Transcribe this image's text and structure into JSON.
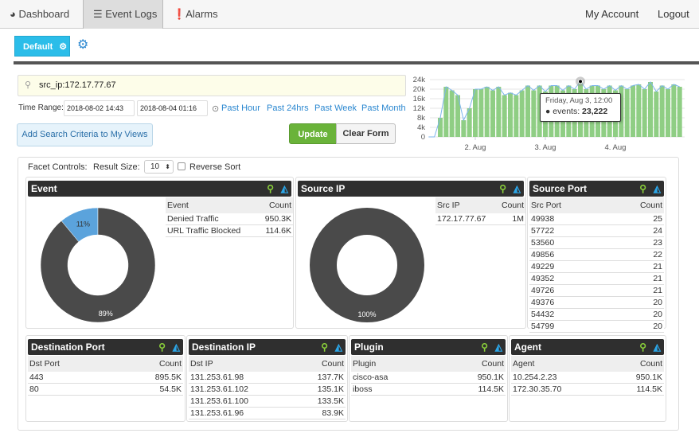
{
  "nav": {
    "tabs": [
      {
        "label": "Dashboard",
        "icon": "pie-chart-icon"
      },
      {
        "label": "Event Logs",
        "icon": "list-icon",
        "active": true
      },
      {
        "label": "Alarms",
        "icon": "exclamation-icon"
      }
    ],
    "my_account": "My Account",
    "logout": "Logout"
  },
  "views": {
    "default_label": "Default"
  },
  "search": {
    "query": "src_ip:172.17.77.67"
  },
  "time_range": {
    "label": "Time Range:",
    "start": "2018-08-02 14:43",
    "end": "2018-08-04 01:16",
    "presets": [
      "Past Hour",
      "Past 24hrs",
      "Past Week",
      "Past Month"
    ]
  },
  "buttons": {
    "add_criteria": "Add Search Criteria to My Views",
    "update": "Update",
    "clear": "Clear Form"
  },
  "colors": {
    "accent": "#2bbde9",
    "bar": "#8fce84",
    "line": "#7cb5ec",
    "donut_main": "#4a4a4a",
    "donut_secondary": "#5ba3dc",
    "update": "#6ab33a"
  },
  "chart_data": {
    "type": "bar",
    "yticks": [
      "0",
      "4k",
      "8k",
      "12k",
      "16k",
      "20k",
      "24k"
    ],
    "ylim": [
      0,
      24000
    ],
    "xticks": [
      "2. Aug",
      "3. Aug",
      "4. Aug"
    ],
    "tooltip": {
      "date": "Friday, Aug 3, 12:00",
      "series": "events",
      "value": "23,222"
    },
    "series": [
      {
        "name": "events",
        "x": [
          "2018-08-01 08:00",
          "2018-08-01 10:00",
          "2018-08-01 12:00",
          "2018-08-01 14:00",
          "2018-08-01 16:00",
          "2018-08-01 18:00",
          "2018-08-01 20:00",
          "2018-08-01 22:00",
          "2018-08-02 00:00",
          "2018-08-02 02:00",
          "2018-08-02 04:00",
          "2018-08-02 06:00",
          "2018-08-02 08:00",
          "2018-08-02 10:00",
          "2018-08-02 12:00",
          "2018-08-02 14:00",
          "2018-08-02 16:00",
          "2018-08-02 18:00",
          "2018-08-02 20:00",
          "2018-08-02 22:00",
          "2018-08-03 00:00",
          "2018-08-03 02:00",
          "2018-08-03 04:00",
          "2018-08-03 06:00",
          "2018-08-03 08:00",
          "2018-08-03 10:00",
          "2018-08-03 12:00",
          "2018-08-03 14:00",
          "2018-08-03 16:00",
          "2018-08-03 18:00",
          "2018-08-03 20:00",
          "2018-08-03 22:00",
          "2018-08-04 00:00",
          "2018-08-04 02:00",
          "2018-08-04 04:00",
          "2018-08-04 06:00",
          "2018-08-04 08:00",
          "2018-08-04 10:00",
          "2018-08-04 12:00",
          "2018-08-04 14:00",
          "2018-08-04 16:00",
          "2018-08-04 18:00",
          "2018-08-04 20:00",
          "2018-08-04 22:00"
        ],
        "values": [
          0,
          0,
          8000,
          21000,
          19500,
          17500,
          7000,
          12000,
          20000,
          20000,
          21000,
          19500,
          21000,
          17500,
          18500,
          17500,
          19500,
          21500,
          19500,
          21500,
          19000,
          21500,
          21500,
          19500,
          21500,
          20000,
          23222,
          20000,
          21500,
          21500,
          20000,
          21500,
          19500,
          21500,
          20000,
          21500,
          22000,
          20000,
          23000,
          19000,
          21500,
          20000,
          22000,
          21000
        ]
      }
    ]
  },
  "facet": {
    "label": "Facet Controls:",
    "result_size_label": "Result Size:",
    "result_size": "10",
    "reverse_sort": "Reverse Sort"
  },
  "panels": {
    "event": {
      "title": "Event",
      "cols": [
        "Event",
        "Count"
      ],
      "rows": [
        [
          "Denied Traffic",
          "950.3K"
        ],
        [
          "URL Traffic Blocked",
          "114.6K"
        ]
      ],
      "pie": [
        {
          "pct": 89,
          "label": "89%"
        },
        {
          "pct": 11,
          "label": "11%"
        }
      ]
    },
    "source_ip": {
      "title": "Source IP",
      "cols": [
        "Src IP",
        "Count"
      ],
      "rows": [
        [
          "172.17.77.67",
          "1M"
        ]
      ],
      "pie": [
        {
          "pct": 100,
          "label": "100%"
        }
      ]
    },
    "source_port": {
      "title": "Source Port",
      "cols": [
        "Src Port",
        "Count"
      ],
      "rows": [
        [
          "49938",
          "25"
        ],
        [
          "57722",
          "24"
        ],
        [
          "53560",
          "23"
        ],
        [
          "49856",
          "22"
        ],
        [
          "49229",
          "21"
        ],
        [
          "49352",
          "21"
        ],
        [
          "49726",
          "21"
        ],
        [
          "49376",
          "20"
        ],
        [
          "54432",
          "20"
        ],
        [
          "54799",
          "20"
        ]
      ]
    },
    "dst_port": {
      "title": "Destination Port",
      "cols": [
        "Dst Port",
        "Count"
      ],
      "rows": [
        [
          "443",
          "895.5K"
        ],
        [
          "80",
          "54.5K"
        ]
      ]
    },
    "dst_ip": {
      "title": "Destination IP",
      "cols": [
        "Dst IP",
        "Count"
      ],
      "rows": [
        [
          "131.253.61.98",
          "137.7K"
        ],
        [
          "131.253.61.102",
          "135.1K"
        ],
        [
          "131.253.61.100",
          "133.5K"
        ],
        [
          "131.253.61.96",
          "83.9K"
        ]
      ]
    },
    "plugin": {
      "title": "Plugin",
      "cols": [
        "Plugin",
        "Count"
      ],
      "rows": [
        [
          "cisco-asa",
          "950.1K"
        ],
        [
          "iboss",
          "114.5K"
        ]
      ]
    },
    "agent": {
      "title": "Agent",
      "cols": [
        "Agent",
        "Count"
      ],
      "rows": [
        [
          "10.254.2.23",
          "950.1K"
        ],
        [
          "172.30.35.70",
          "114.5K"
        ]
      ]
    }
  }
}
